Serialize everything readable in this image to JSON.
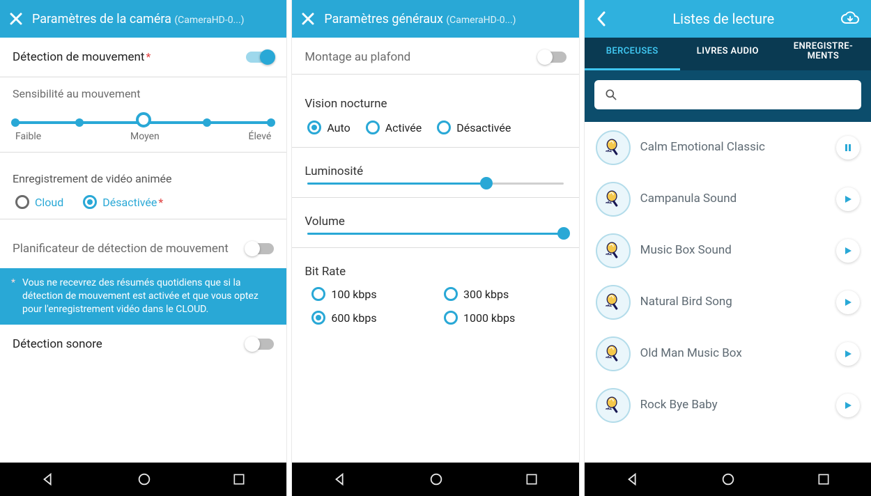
{
  "screen1": {
    "title": "Paramètres de la caméra",
    "subtitle": "(CameraHD-0...)",
    "motion_detect_label": "Détection de mouvement",
    "motion_detect_on": true,
    "sensitivity_label": "Sensibilité au mouvement",
    "sensitivity_ticks": [
      "Faible",
      "Moyen",
      "Élevé"
    ],
    "sensitivity_index": 2,
    "sensitivity_steps": 5,
    "recording_label": "Enregistrement de vidéo animée",
    "recording_options": [
      "Cloud",
      "Désactivée"
    ],
    "recording_selected": 1,
    "scheduler_label": "Planificateur de détection de mouvement",
    "scheduler_on": false,
    "banner_text": "Vous ne recevrez des résumés quotidiens que si la détection de mouvement est activée et que vous optez pour l'enregistrement vidéo dans le CLOUD.",
    "sound_detect_label": "Détection sonore",
    "sound_detect_on": false
  },
  "screen2": {
    "title": "Paramètres généraux",
    "subtitle": "(CameraHD-0...)",
    "ceiling_label": "Montage au plafond",
    "ceiling_on": false,
    "night_label": "Vision nocturne",
    "night_options": [
      "Auto",
      "Activée",
      "Désactivée"
    ],
    "night_selected": 0,
    "brightness_label": "Luminosité",
    "brightness_pct": 70,
    "volume_label": "Volume",
    "volume_pct": 100,
    "bitrate_label": "Bit Rate",
    "bitrate_options": [
      "100 kbps",
      "300 kbps",
      "600 kbps",
      "1000 kbps"
    ],
    "bitrate_selected": 2
  },
  "screen3": {
    "title": "Listes de lecture",
    "tabs": [
      "BERCEUSES",
      "LIVRES AUDIO",
      "ENREGISTRE-\nMENTS"
    ],
    "active_tab": 0,
    "search_placeholder": "",
    "items": [
      {
        "title": "Calm Emotional Classic",
        "state": "pause"
      },
      {
        "title": "Campanula Sound",
        "state": "play"
      },
      {
        "title": "Music Box Sound",
        "state": "play"
      },
      {
        "title": "Natural Bird Song",
        "state": "play"
      },
      {
        "title": "Old Man Music Box",
        "state": "play"
      },
      {
        "title": "Rock Bye Baby",
        "state": "play"
      }
    ]
  },
  "icons": {
    "close": "✕",
    "back": "‹",
    "cloud": "☁"
  }
}
